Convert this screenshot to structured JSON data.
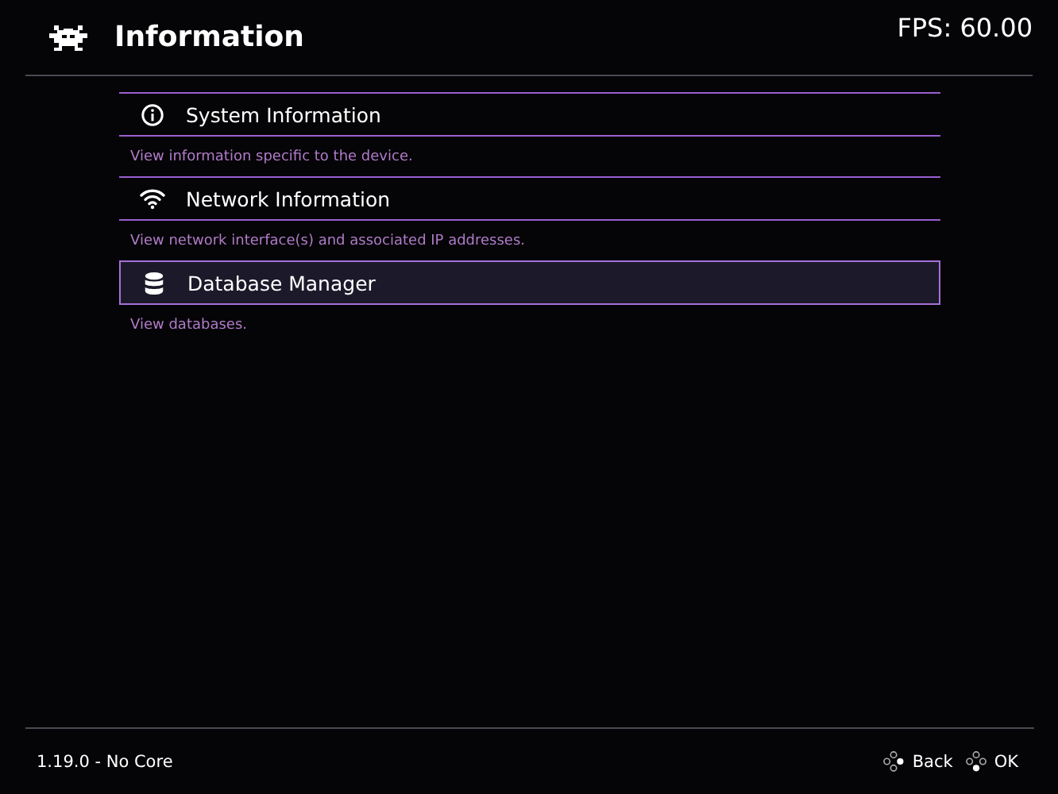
{
  "header": {
    "title": "Information",
    "fps": "FPS:  60.00"
  },
  "items": [
    {
      "kind": "info",
      "label": "System Information",
      "description": "View information specific to the device.",
      "selected": false
    },
    {
      "kind": "wifi",
      "label": "Network Information",
      "description": "View network interface(s) and associated IP addresses.",
      "selected": false
    },
    {
      "kind": "database",
      "label": "Database Manager",
      "description": "View databases.",
      "selected": true
    }
  ],
  "footer": {
    "version": "1.19.0 - No Core",
    "actions": [
      {
        "kind": "back",
        "label": "Back"
      },
      {
        "kind": "ok",
        "label": "OK"
      }
    ]
  }
}
